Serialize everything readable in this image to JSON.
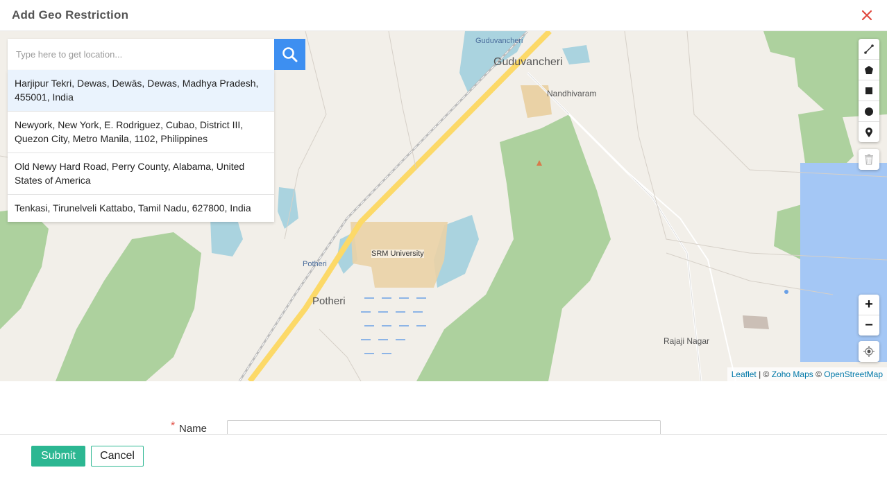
{
  "dialog": {
    "title": "Add Geo Restriction",
    "close_icon": "close-icon"
  },
  "search": {
    "placeholder": "Type here to get location...",
    "button_icon": "search-icon"
  },
  "results": [
    "Harjipur Tekri, Dewas, Dewās, Dewas, Madhya Pradesh, 455001, India",
    "Newyork, New York, E. Rodriguez, Cubao, District III, Quezon City, Metro Manila, 1102, Philippines",
    "Old Newy Hard Road, Perry County, Alabama, United States of America",
    "Tenkasi, Tirunelveli Kattabo, Tamil Nadu, 627800, India"
  ],
  "map_labels": {
    "guduvancheri_small": "Guduvancheri",
    "guduvancheri_big": "Guduvancheri",
    "nandhivaram": "Nandhivaram",
    "srm": "SRM University",
    "potheri_small": "Potheri",
    "potheri_big": "Potheri",
    "rajaji": "Rajaji Nagar"
  },
  "draw_tools": [
    "polyline-icon",
    "polygon-icon",
    "rectangle-icon",
    "circle-icon",
    "marker-icon"
  ],
  "delete_icon": "trash-icon",
  "zoom": {
    "in": "+",
    "out": "−"
  },
  "locate_icon": "locate-icon",
  "attribution": {
    "leaflet": "Leaflet",
    "sep": " | © ",
    "zoho": "Zoho Maps",
    "sep2": " © ",
    "osm": "OpenStreetMap"
  },
  "form": {
    "required_mark": "*",
    "name_label": "Name"
  },
  "footer": {
    "submit": "Submit",
    "cancel": "Cancel"
  },
  "colors": {
    "primary_green": "#2cb792",
    "search_blue": "#3d8ff1",
    "close_red": "#e0483e"
  }
}
